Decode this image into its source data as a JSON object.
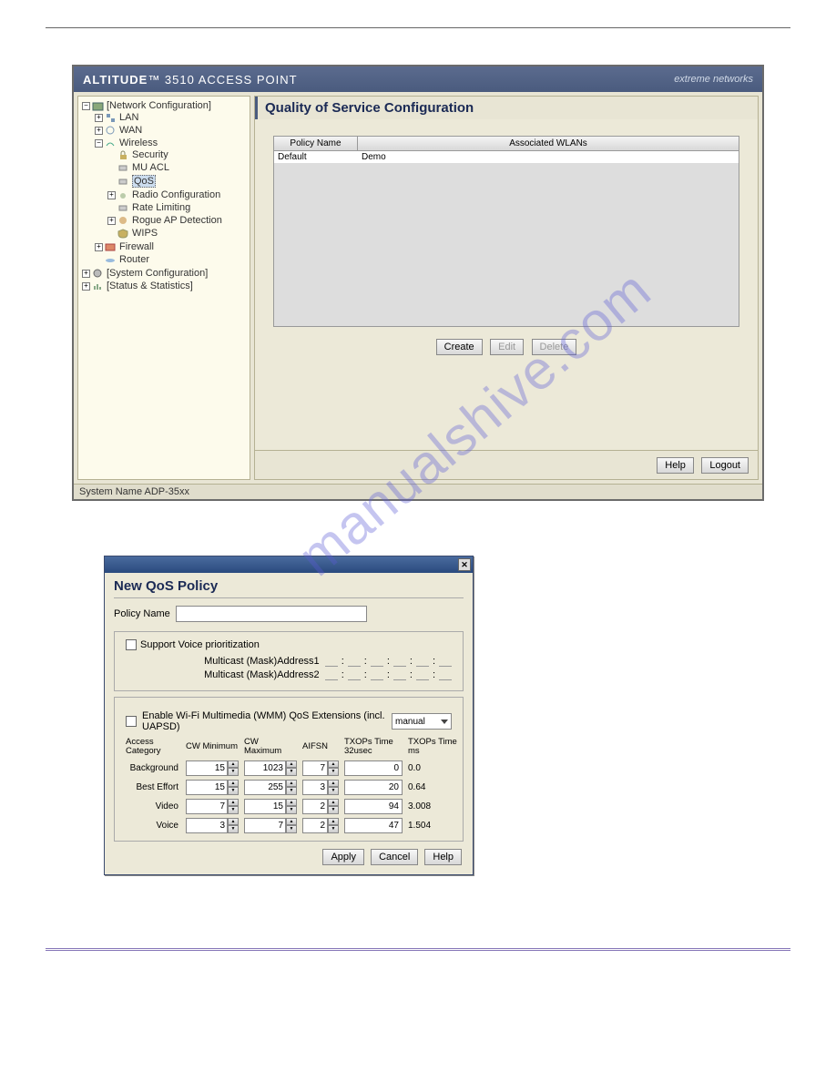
{
  "title": {
    "brand_bold": "ALTITUDE",
    "brand_tm": "™",
    "brand_model": " 3510 ",
    "brand_rest": "ACCESS POINT",
    "logo": "extreme networks"
  },
  "tree": {
    "n0": "[Network Configuration]",
    "n1": "LAN",
    "n2": "WAN",
    "n3": "Wireless",
    "n4": "Security",
    "n5": "MU ACL",
    "n6": "QoS",
    "n7": "Radio Configuration",
    "n8": "Rate Limiting",
    "n9": "Rogue AP Detection",
    "n10": "WIPS",
    "n11": "Firewall",
    "n12": "Router",
    "s0": "[System Configuration]",
    "st0": "[Status & Statistics]"
  },
  "content": {
    "title": "Quality of Service Configuration",
    "col_policy": "Policy Name",
    "col_wlans": "Associated WLANs",
    "row1_policy": "Default",
    "row1_wlans": "Demo",
    "btn_create": "Create",
    "btn_edit": "Edit",
    "btn_delete": "Delete",
    "btn_help": "Help",
    "btn_logout": "Logout"
  },
  "status": "System Name ADP-35xx",
  "watermark": "manualshive.com",
  "dialog": {
    "heading": "New QoS Policy",
    "policy_name_lbl": "Policy Name",
    "voice_chk": "Support Voice prioritization",
    "mc1": "Multicast (Mask)Address1",
    "mc2": "Multicast (Mask)Address2",
    "wmm_chk": "Enable Wi-Fi Multimedia (WMM) QoS Extensions (incl. UAPSD)",
    "wmm_sel": "manual",
    "hd_cat": "Access Category",
    "hd_cwmin": "CW Minimum",
    "hd_cwmax": "CW Maximum",
    "hd_aifsn": "AIFSN",
    "hd_txop32": "TXOPs Time 32usec",
    "hd_txopms": "TXOPs Time ms",
    "cat_bg": "Background",
    "cat_be": "Best Effort",
    "cat_vi": "Video",
    "cat_vo": "Voice",
    "bg_cwmin": "15",
    "bg_cwmax": "1023",
    "bg_aifsn": "7",
    "bg_txop": "0",
    "bg_ms": "0.0",
    "be_cwmin": "15",
    "be_cwmax": "255",
    "be_aifsn": "3",
    "be_txop": "20",
    "be_ms": "0.64",
    "vi_cwmin": "7",
    "vi_cwmax": "15",
    "vi_aifsn": "2",
    "vi_txop": "94",
    "vi_ms": "3.008",
    "vo_cwmin": "3",
    "vo_cwmax": "7",
    "vo_aifsn": "2",
    "vo_txop": "47",
    "vo_ms": "1.504",
    "btn_apply": "Apply",
    "btn_cancel": "Cancel",
    "btn_help": "Help"
  }
}
